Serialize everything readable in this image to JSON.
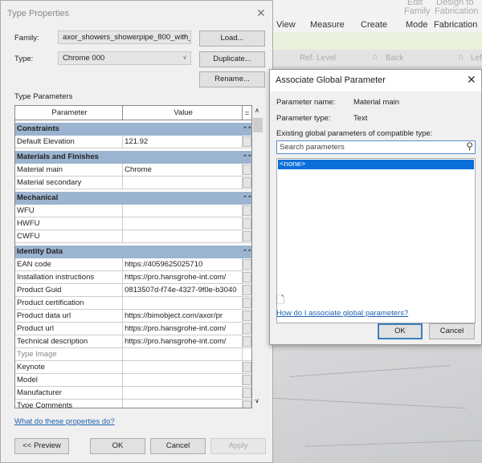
{
  "background_app": {
    "ribbon": {
      "labels": [
        "View",
        "Measure",
        "Create",
        "Mode",
        "Fabrication"
      ],
      "dim_labels": [
        "Edit",
        "Family",
        "Design to",
        "Fabrication"
      ]
    },
    "view_bar": [
      "Ref. Level",
      "Back",
      "Left"
    ]
  },
  "type_properties": {
    "title": "Type Properties",
    "family_label": "Family:",
    "family_value": "axor_showers_showerpipe_800_with_t",
    "type_label": "Type:",
    "type_value": "Chrome 000",
    "load": "Load...",
    "duplicate": "Duplicate...",
    "rename": "Rename...",
    "section": "Type Parameters",
    "columns": [
      "Parameter",
      "Value",
      "="
    ],
    "groups": [
      {
        "name": "Constraints",
        "rows": [
          [
            "Default Elevation",
            "121.92"
          ]
        ]
      },
      {
        "name": "Materials and Finishes",
        "rows": [
          [
            "Material main",
            "Chrome"
          ],
          [
            "Material secondary",
            ""
          ]
        ]
      },
      {
        "name": "Mechanical",
        "rows": [
          [
            "WFU",
            ""
          ],
          [
            "HWFU",
            ""
          ],
          [
            "CWFU",
            ""
          ]
        ]
      },
      {
        "name": "Identity Data",
        "rows": [
          [
            "EAN code",
            "https://4059625025710"
          ],
          [
            "Installation instructions",
            "https://pro.hansgrohe-int.com/"
          ],
          [
            "Product Guid",
            "0813507d-f74e-4327-9f0e-b3040"
          ],
          [
            "Product certification",
            ""
          ],
          [
            "Product data url",
            "https://bimobject.com/axor/pr"
          ],
          [
            "Product url",
            "https://pro.hansgrohe-int.com/"
          ],
          [
            "Technical description",
            "https://pro.hansgrohe-int.com/"
          ],
          [
            "Type Image",
            ""
          ],
          [
            "Keynote",
            ""
          ],
          [
            "Model",
            ""
          ],
          [
            "Manufacturer",
            ""
          ],
          [
            "Type Comments",
            ""
          ]
        ]
      }
    ],
    "help_link": "What do these properties do?",
    "preview": "<< Preview",
    "ok": "OK",
    "cancel": "Cancel",
    "apply": "Apply"
  },
  "associate_dialog": {
    "title": "Associate Global Parameter",
    "name_label": "Parameter name:",
    "name_value": "Material main",
    "type_label": "Parameter type:",
    "type_value": "Text",
    "existing_label": "Existing global parameters of compatible type:",
    "search_placeholder": "Search parameters",
    "items": [
      "<none>"
    ],
    "help_link": "How do I associate global parameters?",
    "ok": "OK",
    "cancel": "Cancel"
  },
  "colors": {
    "group_header": "#9bb4cf",
    "selection": "#0a6fd8",
    "link": "#1f62b0"
  }
}
